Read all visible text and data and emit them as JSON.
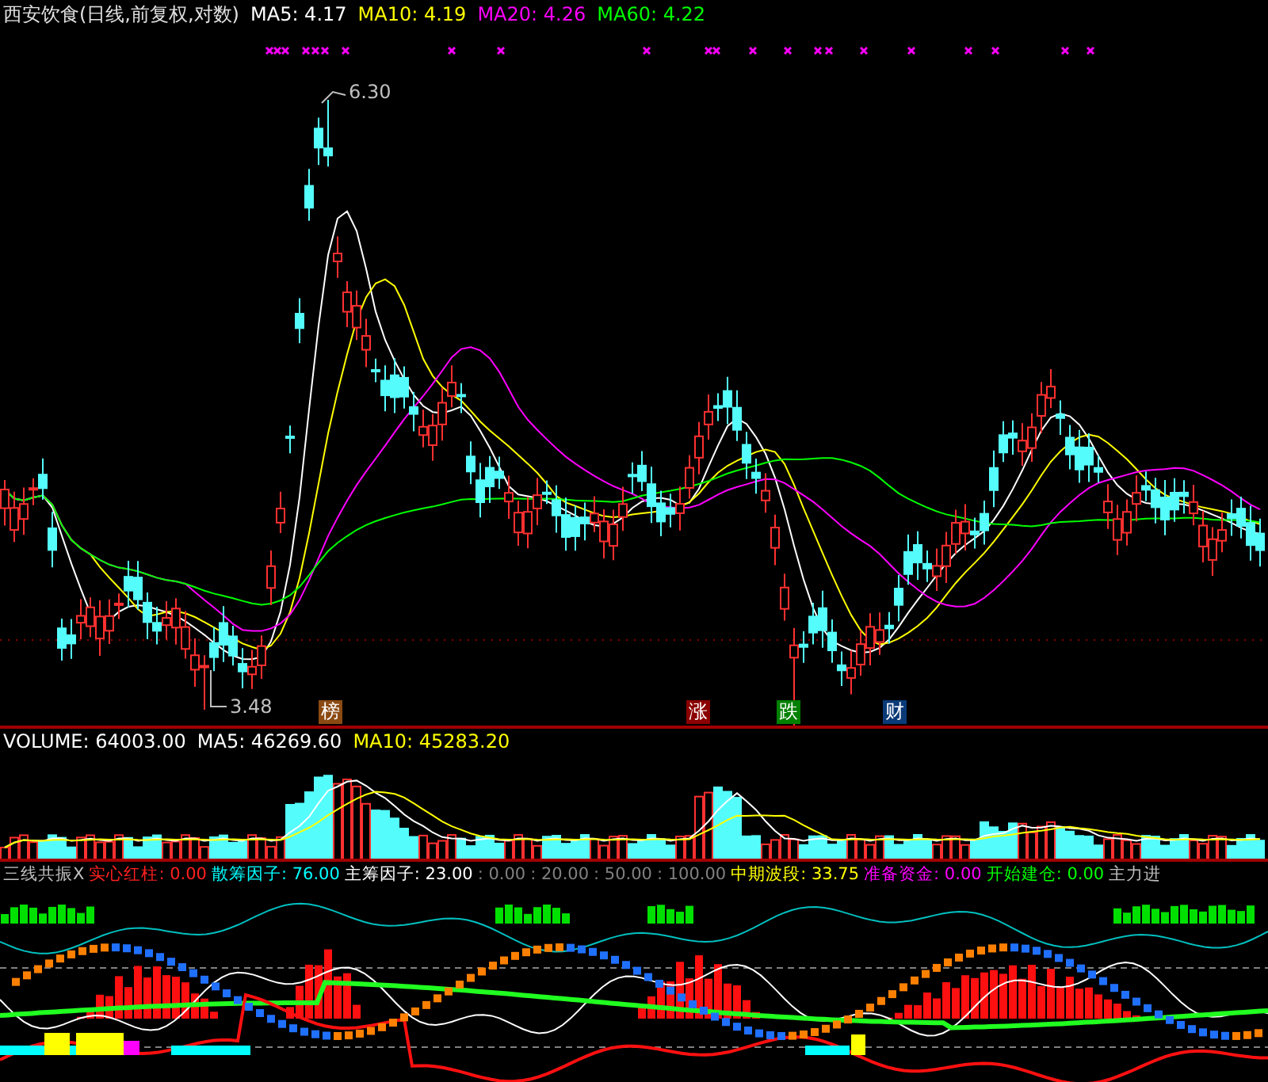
{
  "header": {
    "title": "西安饮食(日线,前复权,对数)",
    "readings": [
      {
        "label": "MA5: 4.17",
        "color": "#ffffff"
      },
      {
        "label": "MA10: 4.19",
        "color": "#ffff00"
      },
      {
        "label": "MA20: 4.26",
        "color": "#ff00ff"
      },
      {
        "label": "MA60: 4.22",
        "color": "#00ff00"
      }
    ]
  },
  "main_chart": {
    "high_label": "6.30",
    "low_label": "3.48",
    "badges": [
      {
        "text": "榜",
        "color": "#8b4a12"
      },
      {
        "text": "涨",
        "color": "#8b0000"
      },
      {
        "text": "跌",
        "color": "#008000"
      },
      {
        "text": "财",
        "color": "#0b3a78"
      }
    ]
  },
  "volume": {
    "readings": [
      {
        "label": "VOLUME: 64003.00",
        "color": "#ffffff"
      },
      {
        "label": "MA5: 46269.60",
        "color": "#ffffff"
      },
      {
        "label": "MA10: 45283.20",
        "color": "#ffff00"
      }
    ]
  },
  "indicator": {
    "readings": [
      {
        "label": "三线共振X",
        "color": "#c0c0c0"
      },
      {
        "label": "实心红柱: 0.00",
        "color": "#ff2020"
      },
      {
        "label": "散筹因子: 76.00",
        "color": "#00ffff"
      },
      {
        "label": "主筹因子: 23.00",
        "color": "#ffffff"
      },
      {
        "label": ": 0.00",
        "color": "#808080"
      },
      {
        "label": ": 20.00",
        "color": "#808080"
      },
      {
        "label": ": 50.00",
        "color": "#808080"
      },
      {
        "label": ": 100.00",
        "color": "#808080"
      },
      {
        "label": "中期波段: 33.75",
        "color": "#ffff00"
      },
      {
        "label": "准备资金: 0.00",
        "color": "#ff00ff"
      },
      {
        "label": "开始建仓: 0.00",
        "color": "#00ff00"
      },
      {
        "label": "主力进",
        "color": "#c0c0c0"
      }
    ]
  }
}
